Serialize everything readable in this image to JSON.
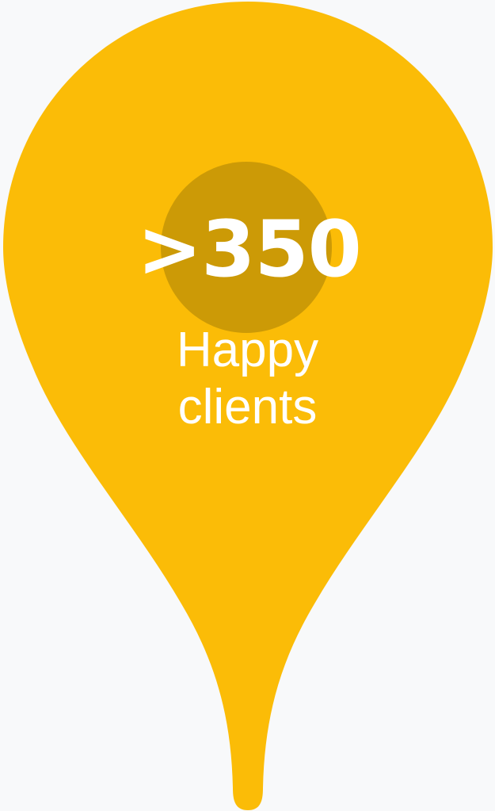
{
  "stat": {
    "value": ">350",
    "label_line1": "Happy",
    "label_line2": "clients"
  },
  "colors": {
    "background": "#f8f9fa",
    "pin": "#fbbc07",
    "pin_hole": "#cc9a06",
    "text": "#ffffff"
  },
  "icons": {
    "pin": "map-pin-icon"
  }
}
